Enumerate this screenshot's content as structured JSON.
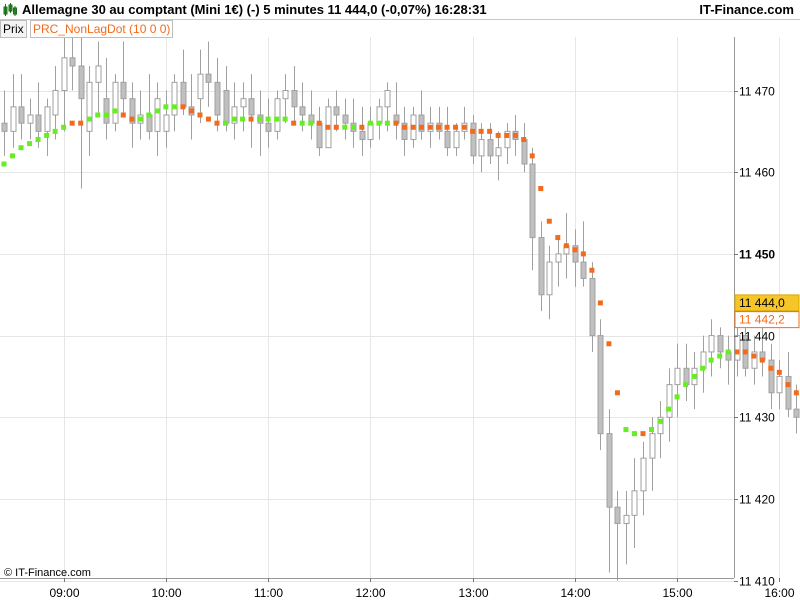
{
  "header": {
    "title": "Allemagne 30 au comptant (Mini 1€) (-)   5 minutes   11 444,0 (-0,07%)   16:28:31",
    "brand": "IT-Finance.com"
  },
  "subheader": {
    "prix_label": "Prix",
    "indicator_label": "PRC_NonLagDot (10 0 0)"
  },
  "footer": {
    "copyright": "© IT-Finance.com"
  },
  "colors": {
    "bullish": "#ffffff",
    "bearish": "#c0c0c0",
    "wick": "#a0a0a0",
    "dot_up": "#66ee22",
    "dot_down": "#f26b1d",
    "last_price_bg": "#f6c629",
    "indicator_tag": "#f26b1d"
  },
  "chart_data": {
    "type": "candlestick",
    "instrument": "Allemagne 30 au comptant (Mini 1€)",
    "timeframe": "5 minutes",
    "ylim": [
      11408,
      11482
    ],
    "y_ticks": [
      {
        "value": 11410,
        "label": "11 410"
      },
      {
        "value": 11420,
        "label": "11 420"
      },
      {
        "value": 11430,
        "label": "11 430"
      },
      {
        "value": 11440,
        "label": "11 440"
      },
      {
        "value": 11450,
        "label": "11 450"
      },
      {
        "value": 11460,
        "label": "11 460"
      },
      {
        "value": 11470,
        "label": "11 470"
      }
    ],
    "x_ticks": [
      "09:00",
      "10:00",
      "11:00",
      "12:00",
      "13:00",
      "14:00",
      "15:00",
      "16:00"
    ],
    "first_bar_time": "08:25",
    "bar_minutes": 5,
    "last_price": {
      "value": 11444.0,
      "label": "11 444,0"
    },
    "indicator_value": {
      "value": 11442.2,
      "label": "11 442,2"
    },
    "candles": [
      [
        11466,
        11470,
        11462,
        11465
      ],
      [
        11465,
        11472,
        11463,
        11468
      ],
      [
        11468,
        11472,
        11464,
        11466
      ],
      [
        11466,
        11469,
        11464,
        11467
      ],
      [
        11467,
        11471,
        11463,
        11465
      ],
      [
        11465,
        11469,
        11462,
        11468
      ],
      [
        11467,
        11473,
        11464,
        11470
      ],
      [
        11470,
        11477,
        11465,
        11474
      ],
      [
        11474,
        11480,
        11470,
        11473
      ],
      [
        11473,
        11477,
        11458,
        11469
      ],
      [
        11465,
        11473,
        11462,
        11471
      ],
      [
        11471,
        11476,
        11467,
        11473
      ],
      [
        11469,
        11474,
        11464,
        11466
      ],
      [
        11466,
        11472,
        11465,
        11471
      ],
      [
        11471,
        11476,
        11467,
        11469
      ],
      [
        11469,
        11471,
        11463,
        11466
      ],
      [
        11466,
        11470,
        11464,
        11467
      ],
      [
        11467,
        11472,
        11464,
        11465
      ],
      [
        11465,
        11471,
        11462,
        11469
      ],
      [
        11465,
        11470,
        11463,
        11467
      ],
      [
        11467,
        11472,
        11465,
        11471
      ],
      [
        11471,
        11475,
        11467,
        11468
      ],
      [
        11468,
        11472,
        11464,
        11467
      ],
      [
        11469,
        11475,
        11466,
        11472
      ],
      [
        11472,
        11476,
        11468,
        11471
      ],
      [
        11471,
        11474,
        11465,
        11467
      ],
      [
        11470,
        11473,
        11465,
        11466
      ],
      [
        11466,
        11471,
        11464,
        11468
      ],
      [
        11468,
        11471,
        11465,
        11469
      ],
      [
        11469,
        11472,
        11463,
        11467
      ],
      [
        11467,
        11470,
        11462,
        11466
      ],
      [
        11466,
        11469,
        11463,
        11465
      ],
      [
        11465,
        11470,
        11464,
        11469
      ],
      [
        11469,
        11472,
        11466,
        11470
      ],
      [
        11470,
        11473,
        11466,
        11468
      ],
      [
        11468,
        11471,
        11465,
        11467
      ],
      [
        11467,
        11470,
        11464,
        11466
      ],
      [
        11466,
        11468,
        11462,
        11463
      ],
      [
        11463,
        11469,
        11463,
        11468
      ],
      [
        11468,
        11470,
        11465,
        11467
      ],
      [
        11467,
        11469,
        11464,
        11466
      ],
      [
        11466,
        11469,
        11463,
        11465
      ],
      [
        11465,
        11468,
        11462,
        11464
      ],
      [
        11464,
        11468,
        11463,
        11466
      ],
      [
        11466,
        11469,
        11464,
        11468
      ],
      [
        11468,
        11471,
        11465,
        11470
      ],
      [
        11467,
        11471,
        11464,
        11466
      ],
      [
        11466,
        11468,
        11462,
        11464
      ],
      [
        11464,
        11468,
        11463,
        11467
      ],
      [
        11467,
        11470,
        11464,
        11465
      ],
      [
        11465,
        11468,
        11463,
        11466
      ],
      [
        11466,
        11468,
        11464,
        11465
      ],
      [
        11465,
        11468,
        11462,
        11463
      ],
      [
        11463,
        11466,
        11462,
        11465
      ],
      [
        11465,
        11468,
        11464,
        11466
      ],
      [
        11466,
        11467,
        11461,
        11462
      ],
      [
        11462,
        11466,
        11460,
        11464
      ],
      [
        11464,
        11466,
        11461,
        11462
      ],
      [
        11462,
        11465,
        11459,
        11463
      ],
      [
        11463,
        11466,
        11461,
        11465
      ],
      [
        11465,
        11467,
        11462,
        11464
      ],
      [
        11464,
        11466,
        11460,
        11461
      ],
      [
        11461,
        11463,
        11448,
        11452
      ],
      [
        11452,
        11454,
        11443,
        11445
      ],
      [
        11445,
        11451,
        11442,
        11449
      ],
      [
        11449,
        11452,
        11446,
        11450
      ],
      [
        11450,
        11455,
        11447,
        11451
      ],
      [
        11451,
        11453,
        11446,
        11449
      ],
      [
        11449,
        11454,
        11446,
        11447
      ],
      [
        11447,
        11449,
        11438,
        11440
      ],
      [
        11440,
        11442,
        11426,
        11428
      ],
      [
        11428,
        11431,
        11411,
        11419
      ],
      [
        11419,
        11421,
        11410,
        11417
      ],
      [
        11417,
        11421,
        11412,
        11418
      ],
      [
        11418,
        11425,
        11414,
        11421
      ],
      [
        11421,
        11427,
        11418,
        11425
      ],
      [
        11425,
        11430,
        11421,
        11428
      ],
      [
        11428,
        11432,
        11425,
        11430
      ],
      [
        11430,
        11436,
        11427,
        11434
      ],
      [
        11434,
        11439,
        11430,
        11436
      ],
      [
        11436,
        11439,
        11432,
        11434
      ],
      [
        11434,
        11438,
        11431,
        11436
      ],
      [
        11436,
        11440,
        11433,
        11438
      ],
      [
        11438,
        11442,
        11435,
        11440
      ],
      [
        11440,
        11441,
        11436,
        11438
      ],
      [
        11438,
        11440,
        11434,
        11437
      ],
      [
        11437,
        11442,
        11435,
        11440
      ],
      [
        11440,
        11443,
        11435,
        11436
      ],
      [
        11436,
        11440,
        11434,
        11438
      ],
      [
        11438,
        11441,
        11435,
        11437
      ],
      [
        11437,
        11439,
        11431,
        11433
      ],
      [
        11433,
        11437,
        11431,
        11435
      ],
      [
        11435,
        11438,
        11430,
        11431
      ],
      [
        11431,
        11434,
        11428,
        11430
      ],
      [
        11430,
        11435,
        11428,
        11433
      ],
      [
        11433,
        11436,
        11430,
        11431
      ],
      [
        11431,
        11437,
        11430,
        11436
      ],
      [
        11436,
        11442,
        11433,
        11440
      ],
      [
        11440,
        11449,
        11438,
        11446
      ],
      [
        11446,
        11450,
        11442,
        11448
      ],
      [
        11448,
        11450,
        11444,
        11445
      ],
      [
        11445,
        11448,
        11440,
        11442
      ],
      [
        11442,
        11447,
        11440,
        11444
      ],
      [
        11444,
        11447,
        11441,
        11443
      ],
      [
        11443,
        11448,
        11441,
        11446
      ],
      [
        11446,
        11448,
        11442,
        11444
      ]
    ],
    "nonlag_dot": [
      [
        11461,
        "up"
      ],
      [
        11462,
        "up"
      ],
      [
        11463,
        "up"
      ],
      [
        11463.5,
        "up"
      ],
      [
        11464,
        "up"
      ],
      [
        11464.5,
        "up"
      ],
      [
        11465,
        "up"
      ],
      [
        11465.5,
        "up"
      ],
      [
        11466,
        "down"
      ],
      [
        11466,
        "down"
      ],
      [
        11466.5,
        "up"
      ],
      [
        11467,
        "up"
      ],
      [
        11467,
        "up"
      ],
      [
        11467.5,
        "up"
      ],
      [
        11467,
        "down"
      ],
      [
        11466.5,
        "down"
      ],
      [
        11466.5,
        "up"
      ],
      [
        11467,
        "up"
      ],
      [
        11467.5,
        "up"
      ],
      [
        11468,
        "up"
      ],
      [
        11468,
        "up"
      ],
      [
        11468,
        "down"
      ],
      [
        11467.5,
        "down"
      ],
      [
        11467,
        "down"
      ],
      [
        11466.5,
        "down"
      ],
      [
        11466,
        "down"
      ],
      [
        11466,
        "up"
      ],
      [
        11466.5,
        "up"
      ],
      [
        11466.5,
        "up"
      ],
      [
        11466.5,
        "down"
      ],
      [
        11466.5,
        "up"
      ],
      [
        11466.5,
        "up"
      ],
      [
        11466.5,
        "up"
      ],
      [
        11466.5,
        "up"
      ],
      [
        11466,
        "down"
      ],
      [
        11466,
        "up"
      ],
      [
        11466,
        "up"
      ],
      [
        11466,
        "down"
      ],
      [
        11465.5,
        "down"
      ],
      [
        11465.5,
        "down"
      ],
      [
        11465.5,
        "up"
      ],
      [
        11465.5,
        "up"
      ],
      [
        11465.5,
        "down"
      ],
      [
        11466,
        "up"
      ],
      [
        11466,
        "up"
      ],
      [
        11466,
        "up"
      ],
      [
        11466,
        "down"
      ],
      [
        11465.5,
        "down"
      ],
      [
        11465.5,
        "down"
      ],
      [
        11465.5,
        "down"
      ],
      [
        11465.5,
        "down"
      ],
      [
        11465.5,
        "down"
      ],
      [
        11465.5,
        "down"
      ],
      [
        11465.5,
        "down"
      ],
      [
        11465.5,
        "down"
      ],
      [
        11465,
        "down"
      ],
      [
        11465,
        "down"
      ],
      [
        11465,
        "down"
      ],
      [
        11464.5,
        "down"
      ],
      [
        11464.5,
        "down"
      ],
      [
        11464.5,
        "down"
      ],
      [
        11464,
        "down"
      ],
      [
        11462,
        "down"
      ],
      [
        11458,
        "down"
      ],
      [
        11454,
        "down"
      ],
      [
        11452,
        "down"
      ],
      [
        11451,
        "down"
      ],
      [
        11450.5,
        "down"
      ],
      [
        11450,
        "down"
      ],
      [
        11448,
        "down"
      ],
      [
        11444,
        "down"
      ],
      [
        11439,
        "down"
      ],
      [
        11433,
        "down"
      ],
      [
        11428.5,
        "up"
      ],
      [
        11428,
        "up"
      ],
      [
        11428,
        "down"
      ],
      [
        11428.5,
        "up"
      ],
      [
        11429.5,
        "up"
      ],
      [
        11431,
        "up"
      ],
      [
        11432.5,
        "up"
      ],
      [
        11434,
        "up"
      ],
      [
        11435,
        "up"
      ],
      [
        11436,
        "up"
      ],
      [
        11437,
        "up"
      ],
      [
        11437.5,
        "up"
      ],
      [
        11438,
        "up"
      ],
      [
        11438,
        "down"
      ],
      [
        11438,
        "down"
      ],
      [
        11437.5,
        "down"
      ],
      [
        11437,
        "down"
      ],
      [
        11436,
        "down"
      ],
      [
        11435.5,
        "down"
      ],
      [
        11434,
        "down"
      ],
      [
        11433,
        "down"
      ],
      [
        11432.5,
        "down"
      ],
      [
        11432,
        "down"
      ],
      [
        11433,
        "up"
      ],
      [
        11434,
        "up"
      ],
      [
        11436,
        "up"
      ],
      [
        11439,
        "up"
      ],
      [
        11441,
        "up"
      ],
      [
        11442,
        "up"
      ],
      [
        11442.5,
        "down"
      ],
      [
        11442,
        "down"
      ],
      [
        11442.2,
        "down"
      ],
      [
        11442.2,
        "down"
      ]
    ]
  }
}
